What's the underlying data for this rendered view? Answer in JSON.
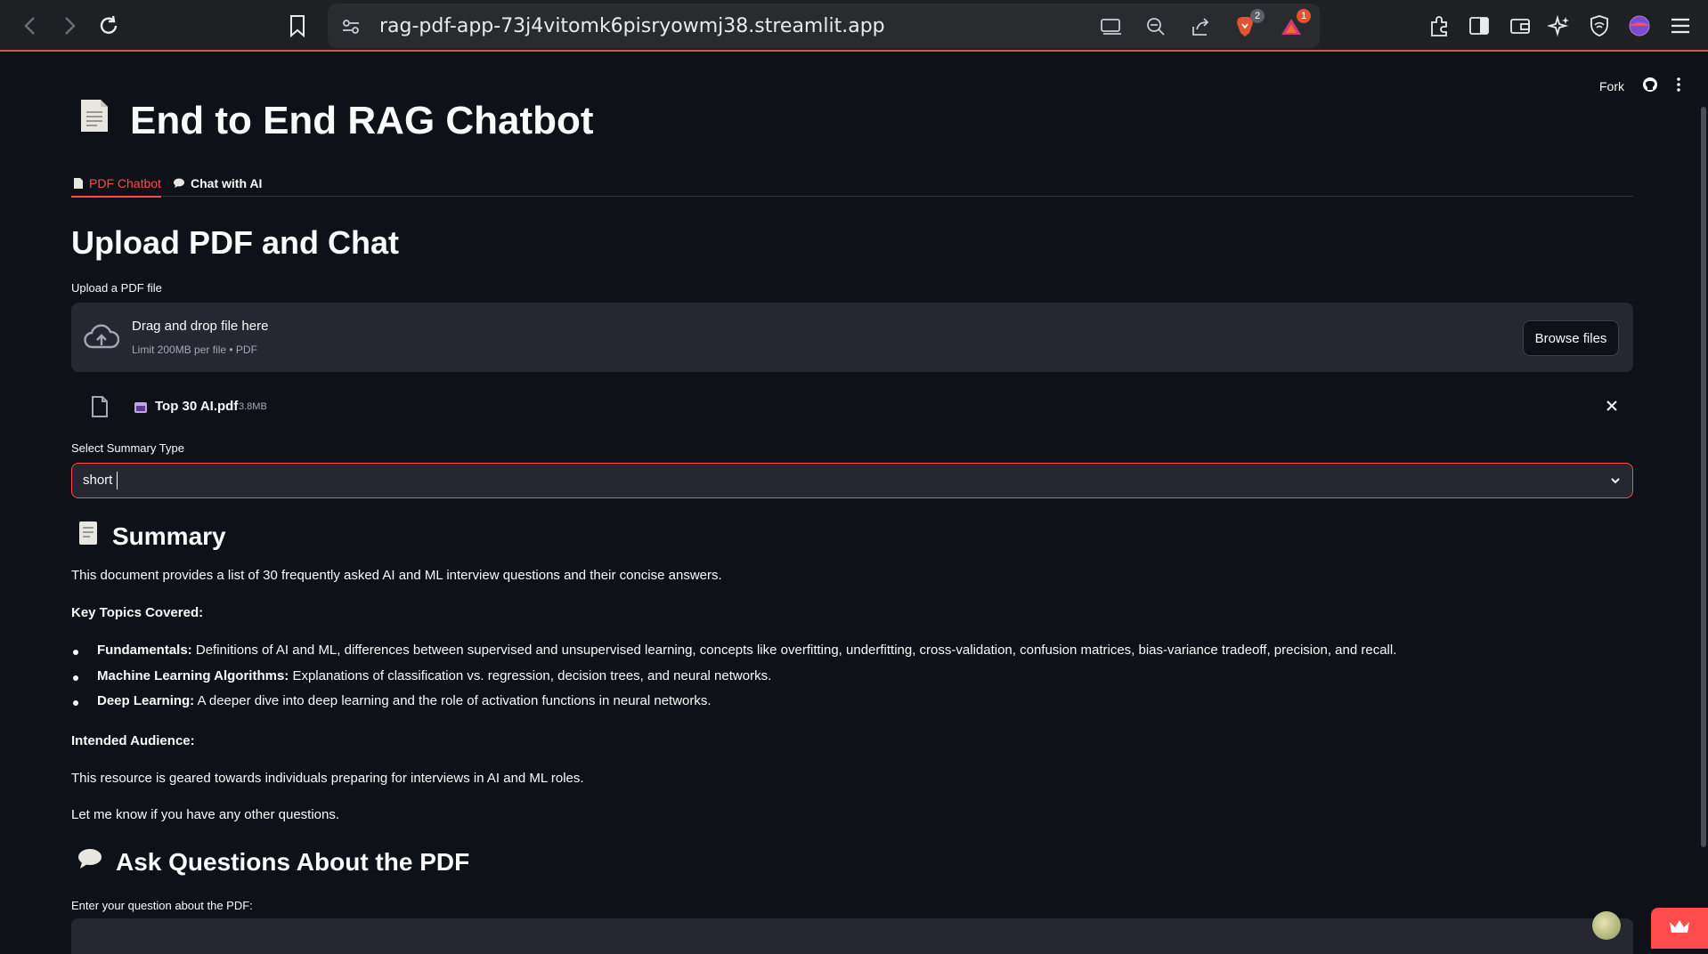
{
  "browser": {
    "url": "rag-pdf-app-73j4vitomk6pisryowmj38.streamlit.app",
    "brave_badge": "2",
    "alert_badge": "1"
  },
  "header": {
    "fork_label": "Fork"
  },
  "app": {
    "title": "End to End RAG Chatbot",
    "tabs": [
      {
        "label": "PDF Chatbot",
        "active": true
      },
      {
        "label": "Chat with AI",
        "active": false
      }
    ],
    "section_title": "Upload PDF and Chat",
    "upload_label": "Upload a PDF file",
    "uploader": {
      "title": "Drag and drop file here",
      "limit": "Limit 200MB per file • PDF",
      "browse_label": "Browse files"
    },
    "file": {
      "name": "Top 30 AI.pdf",
      "size": "3.8MB"
    },
    "select_label": "Select Summary Type",
    "select_value": "short",
    "summary": {
      "heading": "Summary",
      "intro": "This document provides a list of 30 frequently asked AI and ML interview questions and their concise answers.",
      "key_topics_heading": "Key Topics Covered:",
      "topics": [
        {
          "title": "Fundamentals:",
          "text": " Definitions of AI and ML, differences between supervised and unsupervised learning, concepts like overfitting, underfitting, cross-validation, confusion matrices, bias-variance tradeoff, precision, and recall."
        },
        {
          "title": "Machine Learning Algorithms:",
          "text": " Explanations of classification vs. regression, decision trees, and neural networks."
        },
        {
          "title": "Deep Learning:",
          "text": " A deeper dive into deep learning and the role of activation functions in neural networks."
        }
      ],
      "audience_heading": "Intended Audience:",
      "audience_text": "This resource is geared towards individuals preparing for interviews in AI and ML roles.",
      "closing": "Let me know if you have any other questions."
    },
    "questions": {
      "heading": "Ask Questions About the PDF",
      "input_label": "Enter your question about the PDF:"
    }
  },
  "colors": {
    "accent": "#ff4b4b",
    "background": "#0e1117",
    "surface": "#262730"
  }
}
